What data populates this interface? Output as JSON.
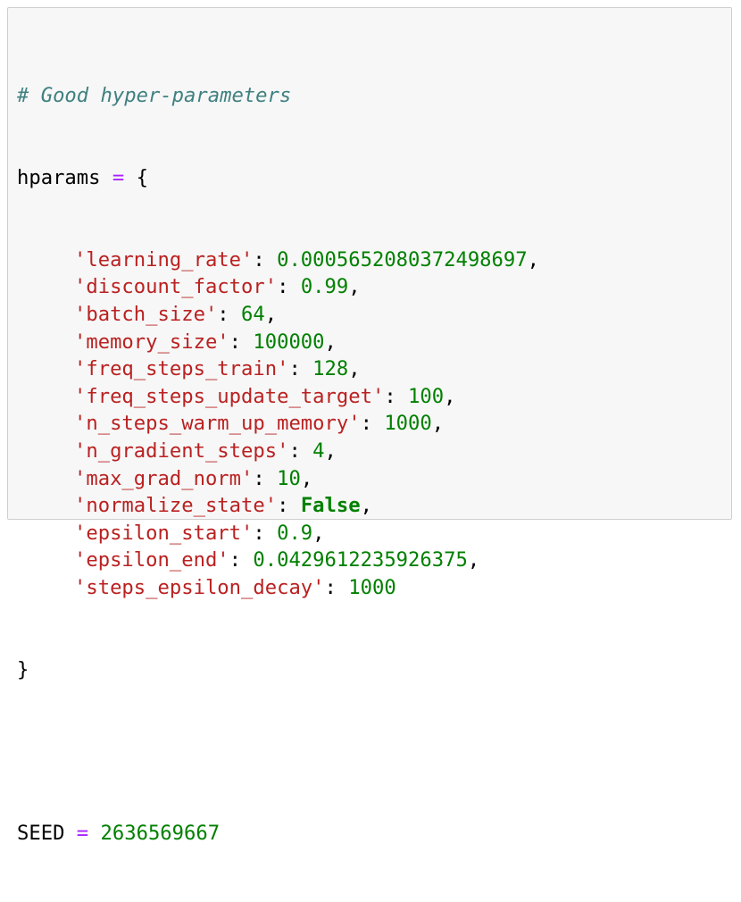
{
  "comment": "# Good hyper-parameters",
  "dict_var": "hparams",
  "assign_op": "=",
  "open_brace": "{",
  "close_brace": "}",
  "entries": [
    {
      "key": "'learning_rate'",
      "value": "0.0005652080372498697",
      "value_type": "number",
      "trail": ","
    },
    {
      "key": "'discount_factor'",
      "value": "0.99",
      "value_type": "number",
      "trail": ","
    },
    {
      "key": "'batch_size'",
      "value": "64",
      "value_type": "number",
      "trail": ","
    },
    {
      "key": "'memory_size'",
      "value": "100000",
      "value_type": "number",
      "trail": ","
    },
    {
      "key": "'freq_steps_train'",
      "value": "128",
      "value_type": "number",
      "trail": ","
    },
    {
      "key": "'freq_steps_update_target'",
      "value": "100",
      "value_type": "number",
      "trail": ","
    },
    {
      "key": "'n_steps_warm_up_memory'",
      "value": "1000",
      "value_type": "number",
      "trail": ","
    },
    {
      "key": "'n_gradient_steps'",
      "value": "4",
      "value_type": "number",
      "trail": ","
    },
    {
      "key": "'max_grad_norm'",
      "value": "10",
      "value_type": "number",
      "trail": ","
    },
    {
      "key": "'normalize_state'",
      "value": "False",
      "value_type": "keyword",
      "trail": ","
    },
    {
      "key": "'epsilon_start'",
      "value": "0.9",
      "value_type": "number",
      "trail": ","
    },
    {
      "key": "'epsilon_end'",
      "value": "0.0429612235926375",
      "value_type": "number",
      "trail": ","
    },
    {
      "key": "'steps_epsilon_decay'",
      "value": "1000",
      "value_type": "number",
      "trail": ""
    }
  ],
  "seed_var": "SEED",
  "seed_value": "2636569667",
  "colors": {
    "comment": "#408080",
    "string": "#ba2121",
    "number": "#008000",
    "keyword": "#008000",
    "operator": "#aa22ff",
    "cell_background": "#f7f7f7",
    "cell_border": "#cfcfcf"
  }
}
